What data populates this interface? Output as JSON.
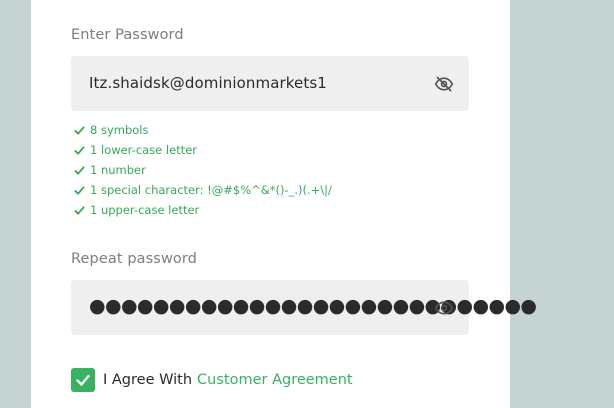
{
  "password_field": {
    "label": "Enter Password",
    "value": "Itz.shaidsk@dominionmarkets1",
    "toggle_icon": "eye-off-icon"
  },
  "rules": [
    {
      "icon": "check-icon",
      "text": "8 symbols"
    },
    {
      "icon": "check-icon",
      "text": "1 lower-case letter"
    },
    {
      "icon": "check-icon",
      "text": "1 number"
    },
    {
      "icon": "check-icon",
      "text": "1 special character: !@#$%^&*()-_.)(.+\\|/"
    },
    {
      "icon": "check-icon",
      "text": "1 upper-case letter"
    }
  ],
  "repeat_field": {
    "label": "Repeat password",
    "value_masked": "●●●●●●●●●●●●●●●●●●●●●●●●●●●●",
    "toggle_icon": "eye-icon"
  },
  "agreement": {
    "checked": true,
    "text": "I Agree With",
    "link_text": "Customer Agreement"
  },
  "colors": {
    "accent": "#3ab063",
    "background": "#c5d4d3",
    "input_bg": "#efefef"
  }
}
